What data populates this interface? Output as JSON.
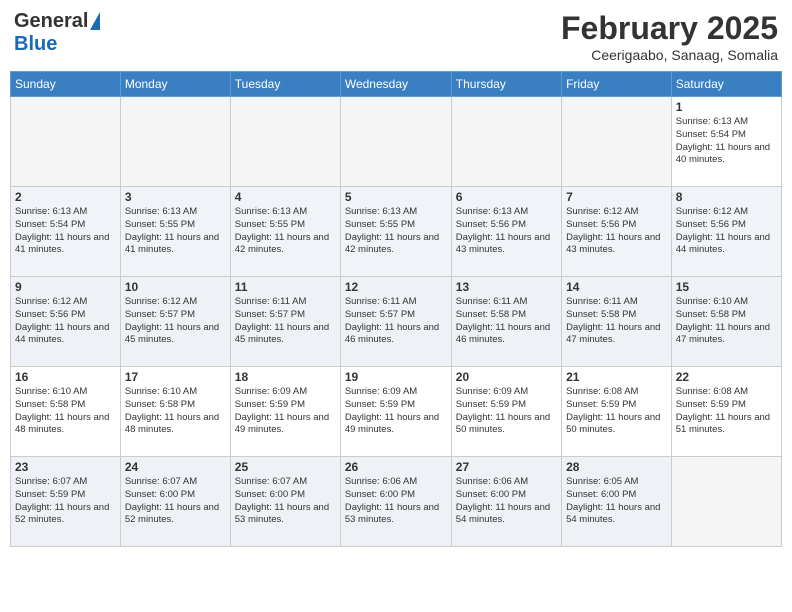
{
  "header": {
    "logo_general": "General",
    "logo_blue": "Blue",
    "month_year": "February 2025",
    "location": "Ceerigaabo, Sanaag, Somalia"
  },
  "weekdays": [
    "Sunday",
    "Monday",
    "Tuesday",
    "Wednesday",
    "Thursday",
    "Friday",
    "Saturday"
  ],
  "weeks": [
    [
      {
        "day": "",
        "empty": true
      },
      {
        "day": "",
        "empty": true
      },
      {
        "day": "",
        "empty": true
      },
      {
        "day": "",
        "empty": true
      },
      {
        "day": "",
        "empty": true
      },
      {
        "day": "",
        "empty": true
      },
      {
        "day": "1",
        "sunrise": "6:13 AM",
        "sunset": "5:54 PM",
        "daylight": "11 hours and 40 minutes."
      }
    ],
    [
      {
        "day": "2",
        "sunrise": "6:13 AM",
        "sunset": "5:54 PM",
        "daylight": "11 hours and 41 minutes."
      },
      {
        "day": "3",
        "sunrise": "6:13 AM",
        "sunset": "5:55 PM",
        "daylight": "11 hours and 41 minutes."
      },
      {
        "day": "4",
        "sunrise": "6:13 AM",
        "sunset": "5:55 PM",
        "daylight": "11 hours and 42 minutes."
      },
      {
        "day": "5",
        "sunrise": "6:13 AM",
        "sunset": "5:55 PM",
        "daylight": "11 hours and 42 minutes."
      },
      {
        "day": "6",
        "sunrise": "6:13 AM",
        "sunset": "5:56 PM",
        "daylight": "11 hours and 43 minutes."
      },
      {
        "day": "7",
        "sunrise": "6:12 AM",
        "sunset": "5:56 PM",
        "daylight": "11 hours and 43 minutes."
      },
      {
        "day": "8",
        "sunrise": "6:12 AM",
        "sunset": "5:56 PM",
        "daylight": "11 hours and 44 minutes."
      }
    ],
    [
      {
        "day": "9",
        "sunrise": "6:12 AM",
        "sunset": "5:56 PM",
        "daylight": "11 hours and 44 minutes."
      },
      {
        "day": "10",
        "sunrise": "6:12 AM",
        "sunset": "5:57 PM",
        "daylight": "11 hours and 45 minutes."
      },
      {
        "day": "11",
        "sunrise": "6:11 AM",
        "sunset": "5:57 PM",
        "daylight": "11 hours and 45 minutes."
      },
      {
        "day": "12",
        "sunrise": "6:11 AM",
        "sunset": "5:57 PM",
        "daylight": "11 hours and 46 minutes."
      },
      {
        "day": "13",
        "sunrise": "6:11 AM",
        "sunset": "5:58 PM",
        "daylight": "11 hours and 46 minutes."
      },
      {
        "day": "14",
        "sunrise": "6:11 AM",
        "sunset": "5:58 PM",
        "daylight": "11 hours and 47 minutes."
      },
      {
        "day": "15",
        "sunrise": "6:10 AM",
        "sunset": "5:58 PM",
        "daylight": "11 hours and 47 minutes."
      }
    ],
    [
      {
        "day": "16",
        "sunrise": "6:10 AM",
        "sunset": "5:58 PM",
        "daylight": "11 hours and 48 minutes."
      },
      {
        "day": "17",
        "sunrise": "6:10 AM",
        "sunset": "5:58 PM",
        "daylight": "11 hours and 48 minutes."
      },
      {
        "day": "18",
        "sunrise": "6:09 AM",
        "sunset": "5:59 PM",
        "daylight": "11 hours and 49 minutes."
      },
      {
        "day": "19",
        "sunrise": "6:09 AM",
        "sunset": "5:59 PM",
        "daylight": "11 hours and 49 minutes."
      },
      {
        "day": "20",
        "sunrise": "6:09 AM",
        "sunset": "5:59 PM",
        "daylight": "11 hours and 50 minutes."
      },
      {
        "day": "21",
        "sunrise": "6:08 AM",
        "sunset": "5:59 PM",
        "daylight": "11 hours and 50 minutes."
      },
      {
        "day": "22",
        "sunrise": "6:08 AM",
        "sunset": "5:59 PM",
        "daylight": "11 hours and 51 minutes."
      }
    ],
    [
      {
        "day": "23",
        "sunrise": "6:07 AM",
        "sunset": "5:59 PM",
        "daylight": "11 hours and 52 minutes."
      },
      {
        "day": "24",
        "sunrise": "6:07 AM",
        "sunset": "6:00 PM",
        "daylight": "11 hours and 52 minutes."
      },
      {
        "day": "25",
        "sunrise": "6:07 AM",
        "sunset": "6:00 PM",
        "daylight": "11 hours and 53 minutes."
      },
      {
        "day": "26",
        "sunrise": "6:06 AM",
        "sunset": "6:00 PM",
        "daylight": "11 hours and 53 minutes."
      },
      {
        "day": "27",
        "sunrise": "6:06 AM",
        "sunset": "6:00 PM",
        "daylight": "11 hours and 54 minutes."
      },
      {
        "day": "28",
        "sunrise": "6:05 AM",
        "sunset": "6:00 PM",
        "daylight": "11 hours and 54 minutes."
      },
      {
        "day": "",
        "empty": true
      }
    ]
  ]
}
